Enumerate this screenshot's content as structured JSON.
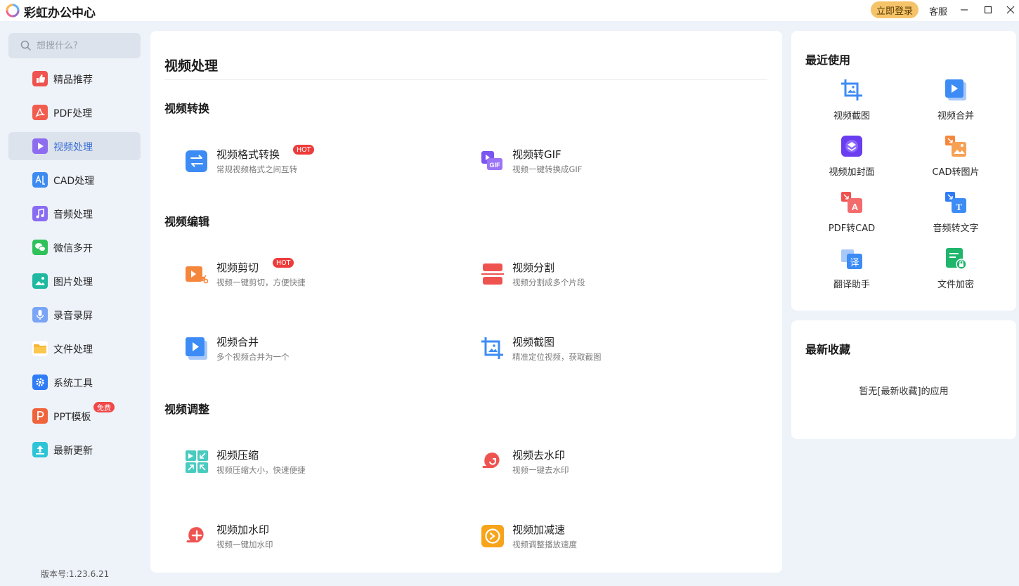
{
  "app": {
    "title": "彩虹办公中心",
    "login": "立即登录",
    "service": "客服"
  },
  "search": {
    "placeholder": "想搜什么?"
  },
  "sidebar": {
    "items": [
      {
        "label": "精品推荐",
        "icon": "thumbs-up-icon"
      },
      {
        "label": "PDF处理",
        "icon": "pdf-icon"
      },
      {
        "label": "视频处理",
        "icon": "video-play-icon",
        "active": true
      },
      {
        "label": "CAD处理",
        "icon": "cad-icon"
      },
      {
        "label": "音频处理",
        "icon": "music-note-icon"
      },
      {
        "label": "微信多开",
        "icon": "wechat-icon"
      },
      {
        "label": "图片处理",
        "icon": "image-icon"
      },
      {
        "label": "录音录屏",
        "icon": "microphone-icon"
      },
      {
        "label": "文件处理",
        "icon": "folder-icon"
      },
      {
        "label": "系统工具",
        "icon": "gear-icon"
      },
      {
        "label": "PPT模板",
        "icon": "ppt-icon",
        "badge": "免费"
      },
      {
        "label": "最新更新",
        "icon": "upload-icon"
      }
    ],
    "version": "版本号:1.23.6.21"
  },
  "main": {
    "title": "视频处理",
    "sections": [
      {
        "title": "视频转换"
      },
      {
        "title": "视频编辑"
      },
      {
        "title": "视频调整"
      }
    ],
    "tools": [
      {
        "name": "视频格式转换",
        "desc": "常规视频格式之间互转",
        "badge": "HOT",
        "icon": "convert-arrows-icon"
      },
      {
        "name": "视频转GIF",
        "desc": "视频一键转换成GIF",
        "icon": "gif-icon"
      },
      {
        "name": "视频剪切",
        "desc": "视频一键剪切，方便快捷",
        "badge": "HOT",
        "icon": "video-scissors-icon"
      },
      {
        "name": "视频分割",
        "desc": "视频分割成多个片段",
        "icon": "split-icon"
      },
      {
        "name": "视频合并",
        "desc": "多个视频合并为一个",
        "icon": "merge-play-icon"
      },
      {
        "name": "视频截图",
        "desc": "精准定位视频，获取截图",
        "icon": "crop-image-icon"
      },
      {
        "name": "视频压缩",
        "desc": "视频压缩大小，快速便捷",
        "icon": "compress-icon"
      },
      {
        "name": "视频去水印",
        "desc": "视频一键去水印",
        "icon": "remove-watermark-icon"
      },
      {
        "name": "视频加水印",
        "desc": "视频一键加水印",
        "icon": "add-watermark-icon"
      },
      {
        "name": "视频加减速",
        "desc": "视频调整播放速度",
        "icon": "speed-clock-icon"
      }
    ]
  },
  "recent": {
    "title": "最近使用",
    "items": [
      {
        "label": "视频截图",
        "icon": "crop-image-icon"
      },
      {
        "label": "视频合并",
        "icon": "merge-play-icon"
      },
      {
        "label": "视频加封面",
        "icon": "video-cover-icon"
      },
      {
        "label": "CAD转图片",
        "icon": "cad-to-image-icon"
      },
      {
        "label": "PDF转CAD",
        "icon": "pdf-to-cad-icon"
      },
      {
        "label": "音频转文字",
        "icon": "audio-to-text-icon"
      },
      {
        "label": "翻译助手",
        "icon": "translate-icon"
      },
      {
        "label": "文件加密",
        "icon": "file-lock-icon"
      }
    ]
  },
  "favorites": {
    "title": "最新收藏",
    "empty": "暂无[最新收藏]的应用"
  },
  "colors": {
    "accent": "#3b6fd6",
    "hot": "#ee3b3b",
    "login": "#f5c46a",
    "panel_bg": "#eef2f9"
  }
}
